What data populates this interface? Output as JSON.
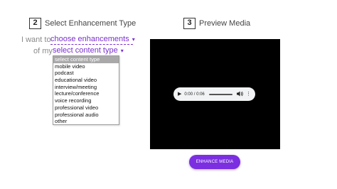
{
  "enhancement": {
    "step_number": "2",
    "title": "Select Enhancement Type",
    "want_text": "I want to",
    "enhancement_select": "choose enhancements",
    "of_my_text": "of my",
    "content_select": "select content type",
    "content_options": [
      "select content type",
      "mobile video",
      "podcast",
      "educational video",
      "interview/meeting",
      "lecture/conference",
      "voice recording",
      "professional video",
      "professional audio",
      "other"
    ],
    "selected_option_index": 0
  },
  "preview": {
    "step_number": "3",
    "title": "Preview Media",
    "player_time": "0:00 / 0:06",
    "play_icon": "play-icon",
    "volume_icon": "volume-icon",
    "menu_icon": "more-options-icon"
  },
  "actions": {
    "enhance_label": "ENHANCE MEDIA"
  },
  "colors": {
    "accent": "#7b2fe0",
    "preview_bg": "#000000",
    "player_bg": "#f1f3f4"
  }
}
